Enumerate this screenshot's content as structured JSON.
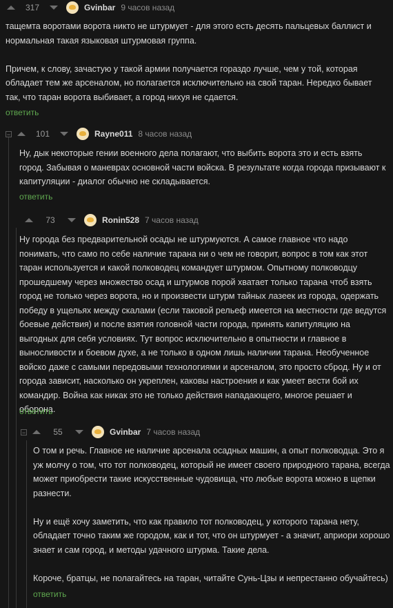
{
  "reply_label": "ответить",
  "colors": {
    "accent_green": "#5fa84f",
    "background": "#161616"
  },
  "comments": [
    {
      "rating": "317",
      "author": "Gvinbar",
      "time": "9 часов назад",
      "paragraphs": [
        "тащемта воротами ворота никто не штурмует - для этого есть десять пальцевых баллист и нормальная такая языковая штурмовая группа.",
        "Причем, к слову, зачастую у такой армии получается гораздо лучше, чем у той, которая обладает тем же арсеналом, но полагается исключительно на свой таран. Нередко бывает так, что таран ворота выбивает, а город нихуя не сдается."
      ]
    },
    {
      "rating": "101",
      "author": "Rayne011",
      "time": "8 часов назад",
      "paragraphs": [
        "Ну, дык некоторые гении военного дела полагают, что выбить ворота это и есть взять город. Забывая о маневрах основной части войска. В результате когда города призывают к капитуляции - диалог обычно не складывается."
      ]
    },
    {
      "rating": "73",
      "author": "Ronin528",
      "time": "7 часов назад",
      "paragraphs": [
        "Ну города без предварительной осады не штурмуются. А самое главное что надо понимать, что само по себе наличие тарана ни о чем не говорит, вопрос в том как этот таран используется и какой полководец командует штурмом. Опытному полководцу прошедшему через множество осад и штурмов порой хватает только тарана чтоб взять город не только через ворота, но и произвести штурм тайных лазеек из города, одержать победу в ущельях между скалами (если таковой рельеф имеется на местности где ведутся боевые действия) и после взятия головной части города, принять капитуляцию на выгодных для себя условиях. Тут вопрос исключительно в опытности и главное в выносливости и боевом духе, а не только в одном лишь наличии тарана. Необученное войско даже с самыми передовыми технологиями и арсеналом, это просто сброд. Ну и от города зависит, насколько он укреплен, каковы настроения и как умеет вести бой их командир. Война как никак это не только действия нападающего, многое решает и оборона."
      ]
    },
    {
      "rating": "55",
      "author": "Gvinbar",
      "time": "7 часов назад",
      "paragraphs": [
        "О том и речь. Главное не наличие арсенала осадных машин, а опыт полководца. Это я уж молчу о том, что тот полководец, который не имеет своего природного тарана, всегда может приобрести такие искусственные чудовища, что любые ворота можно в щепки разнести.",
        "Ну и ещё хочу заметить, что как правило тот полководец, у которого тарана нету, обладает точно таким же городом, как и тот, что он штурмует - а значит, априори хорошо знает и сам город, и методы удачного штурма. Такие дела.",
        "Короче, братцы, не полагайтесь на таран, читайте Сунь-Цзы и непрестанно обучайтесь)"
      ]
    }
  ]
}
